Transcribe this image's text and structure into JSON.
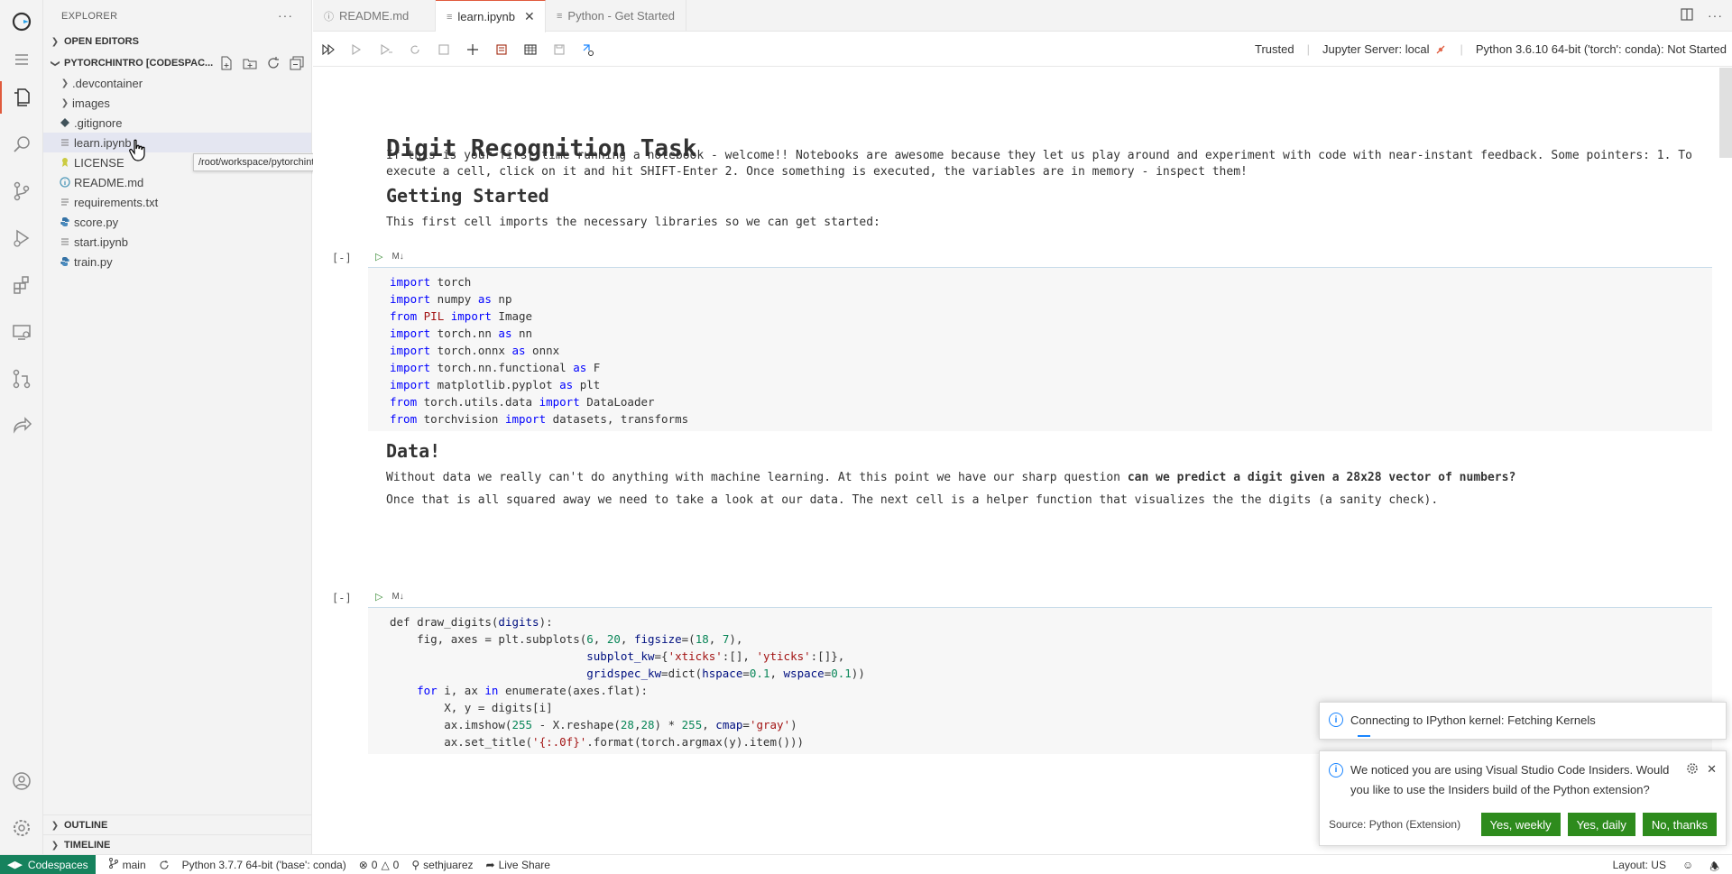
{
  "sidebar": {
    "title": "EXPLORER",
    "more": "···",
    "open_editors": "OPEN EDITORS",
    "folder": "PYTORCHINTRO [CODESPAC...",
    "items": [
      {
        "label": ".devcontainer",
        "type": "folder"
      },
      {
        "label": "images",
        "type": "folder"
      },
      {
        "label": ".gitignore",
        "type": "git"
      },
      {
        "label": "learn.ipynb",
        "type": "notebook"
      },
      {
        "label": "LICENSE",
        "type": "license"
      },
      {
        "label": "README.md",
        "type": "info"
      },
      {
        "label": "requirements.txt",
        "type": "text"
      },
      {
        "label": "score.py",
        "type": "python"
      },
      {
        "label": "start.ipynb",
        "type": "notebook"
      },
      {
        "label": "train.py",
        "type": "python"
      }
    ],
    "tooltip": "/root/workspace/pytorchintro/learn.ipynb",
    "outline": "OUTLINE",
    "timeline": "TIMELINE"
  },
  "tabs": [
    {
      "label": "README.md"
    },
    {
      "label": "learn.ipynb"
    },
    {
      "label": "Python - Get Started"
    }
  ],
  "toolbar": {
    "trusted": "Trusted",
    "server": "Jupyter Server: local",
    "kernel": "Python 3.6.10 64-bit ('torch': conda): Not Started"
  },
  "notebook": {
    "h1": "Digit Recognition Task",
    "intro": "If this is your first time running a notebook - welcome!! Notebooks are awesome because they let us play around and experiment with code with near-instant feedback. Some pointers: 1. To execute a cell, click on it and hit SHIFT-Enter 2. Once something is executed, the variables are in memory - inspect them!",
    "h2_started": "Getting Started",
    "started_text": "This first cell imports the necessary libraries so we can get started:",
    "cell1_count": "[-]",
    "cell_lang": "M↓",
    "h2_data": "Data!",
    "data_text_1": "Without data we really can't do anything with machine learning. At this point we have our sharp question ",
    "data_text_1_bold": "can we predict a digit given a 28x28 vector of numbers?",
    "data_text_2": "Once that is all squared away we need to take a look at our data. The next cell is a helper function that visualizes the the digits (a sanity check).",
    "cell2_count": "[-]"
  },
  "notifications": {
    "kernel": "Connecting to IPython kernel: Fetching Kernels",
    "insiders_1": "We noticed you are using Visual Studio Code Insiders. Would",
    "insiders_2": "you like to use the Insiders build of the Python extension?",
    "source": "Source: Python (Extension)",
    "btn_weekly": "Yes, weekly",
    "btn_daily": "Yes, daily",
    "btn_no": "No, thanks"
  },
  "statusbar": {
    "remote": "Codespaces",
    "branch": "main",
    "python": "Python 3.7.7 64-bit ('base': conda)",
    "problems": "0",
    "warnings": "0",
    "user": "sethjuarez",
    "liveshare": "Live Share",
    "layout": "Layout: US"
  },
  "colors": {
    "accent": "#e05a3c",
    "remote_bg": "#16825d",
    "button_green": "#2e8b1d",
    "info_blue": "#1a85ff"
  }
}
